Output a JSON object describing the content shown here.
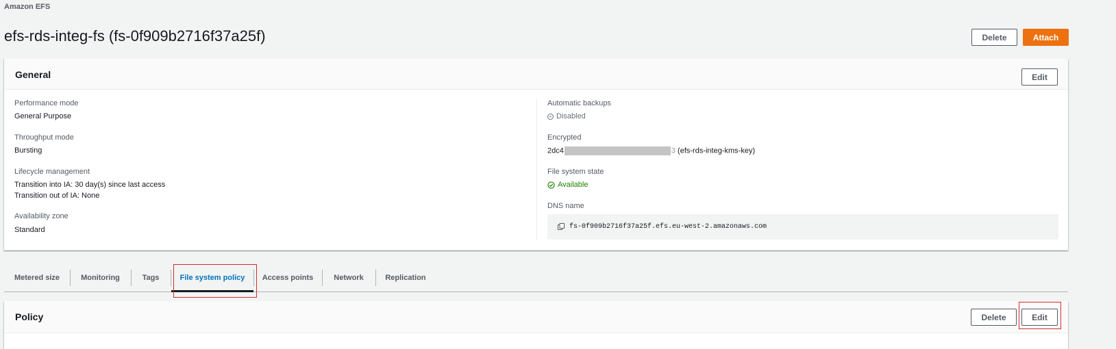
{
  "breadcrumb": "Amazon EFS",
  "title": "efs-rds-integ-fs (fs-0f909b2716f37a25f)",
  "header_actions": {
    "delete": "Delete",
    "attach": "Attach"
  },
  "general": {
    "title": "General",
    "edit": "Edit",
    "left": [
      {
        "label": "Performance mode",
        "value": "General Purpose"
      },
      {
        "label": "Throughput mode",
        "value": "Bursting"
      },
      {
        "label": "Lifecycle management",
        "value_lines": [
          "Transition into IA: 30 day(s) since last access",
          "Transition out of IA: None"
        ]
      },
      {
        "label": "Availability zone",
        "value": "Standard"
      }
    ],
    "right": {
      "backups": {
        "label": "Automatic backups",
        "value": "Disabled"
      },
      "encrypted": {
        "label": "Encrypted",
        "prefix": "2dc4",
        "suffix": "3",
        "key_name": "(efs-rds-integ-kms-key)"
      },
      "state": {
        "label": "File system state",
        "value": "Available"
      },
      "dns": {
        "label": "DNS name",
        "value": "fs-0f909b2716f37a25f.efs.eu-west-2.amazonaws.com"
      }
    }
  },
  "tabs": [
    "Metered size",
    "Monitoring",
    "Tags",
    "File system policy",
    "Access points",
    "Network",
    "Replication"
  ],
  "active_tab": "File system policy",
  "policy": {
    "title": "Policy",
    "delete": "Delete",
    "edit": "Edit"
  },
  "colors": {
    "primary": "#ec7211",
    "link": "#0073bb",
    "success": "#1d8102",
    "highlight": "#d12e2e"
  },
  "icons": {
    "backups": "minus-circle-icon",
    "state": "check-circle-icon",
    "dns": "copy-icon"
  }
}
